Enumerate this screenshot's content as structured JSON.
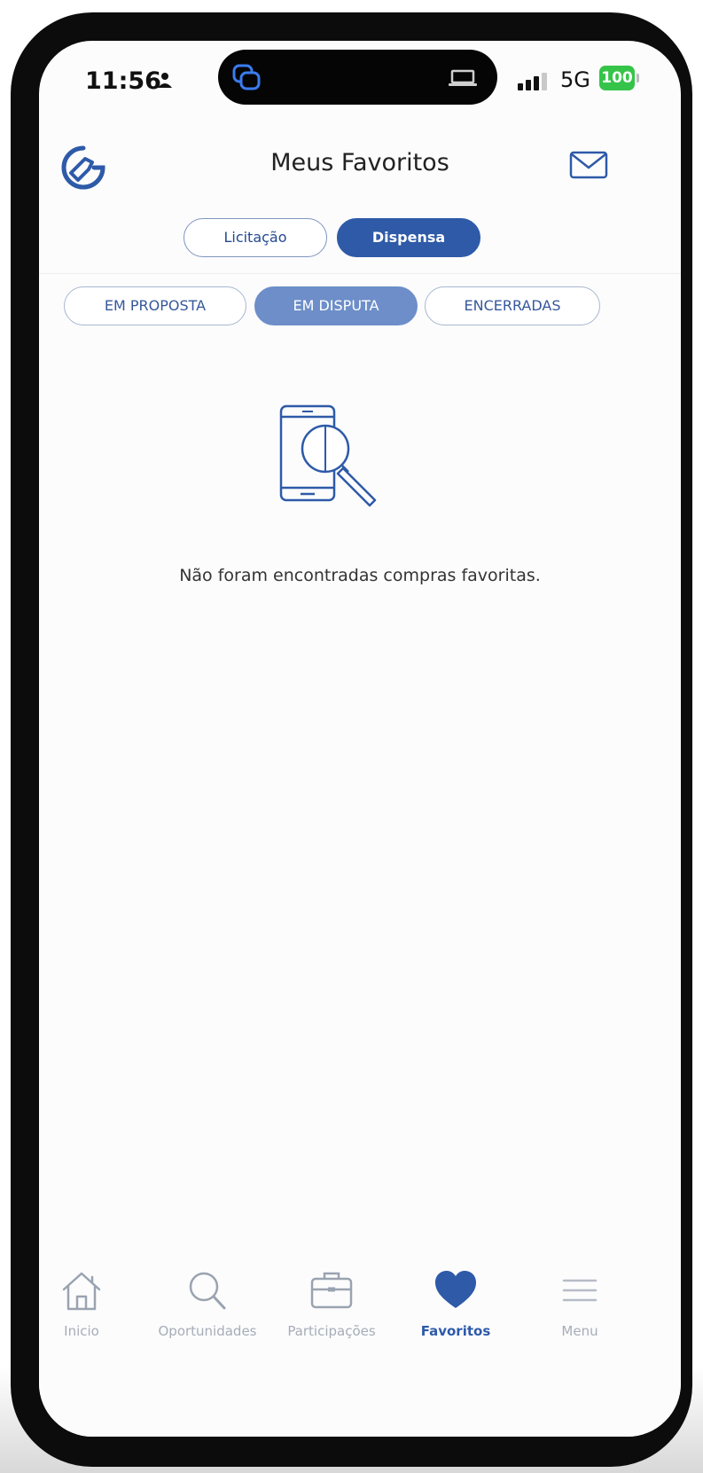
{
  "status_bar": {
    "time": "11:56",
    "network": "5G",
    "battery": "100"
  },
  "header": {
    "title": "Meus Favoritos",
    "logo_icon": "brand-logo-icon",
    "mail_icon": "envelope-icon"
  },
  "type_toggle": {
    "options": [
      {
        "label": "Licitação",
        "selected": false
      },
      {
        "label": "Dispensa",
        "selected": true
      }
    ]
  },
  "status_tabs": [
    {
      "label": "EM PROPOSTA",
      "selected": false
    },
    {
      "label": "EM DISPUTA",
      "selected": true
    },
    {
      "label": "ENCERRADAS",
      "selected": false
    }
  ],
  "empty_state": {
    "icon": "phone-search-icon",
    "message": "Não foram encontradas compras favoritas."
  },
  "bottom_nav": [
    {
      "label": "Inicio",
      "icon": "home-icon",
      "active": false
    },
    {
      "label": "Oportunidades",
      "icon": "search-icon",
      "active": false
    },
    {
      "label": "Participações",
      "icon": "briefcase-icon",
      "active": false
    },
    {
      "label": "Favoritos",
      "icon": "heart-icon",
      "active": true
    },
    {
      "label": "Menu",
      "icon": "hamburger-menu-icon",
      "active": false
    }
  ],
  "colors": {
    "primary": "#2e5aa8",
    "active_tab": "#6d8ec9",
    "battery": "#35c449"
  }
}
